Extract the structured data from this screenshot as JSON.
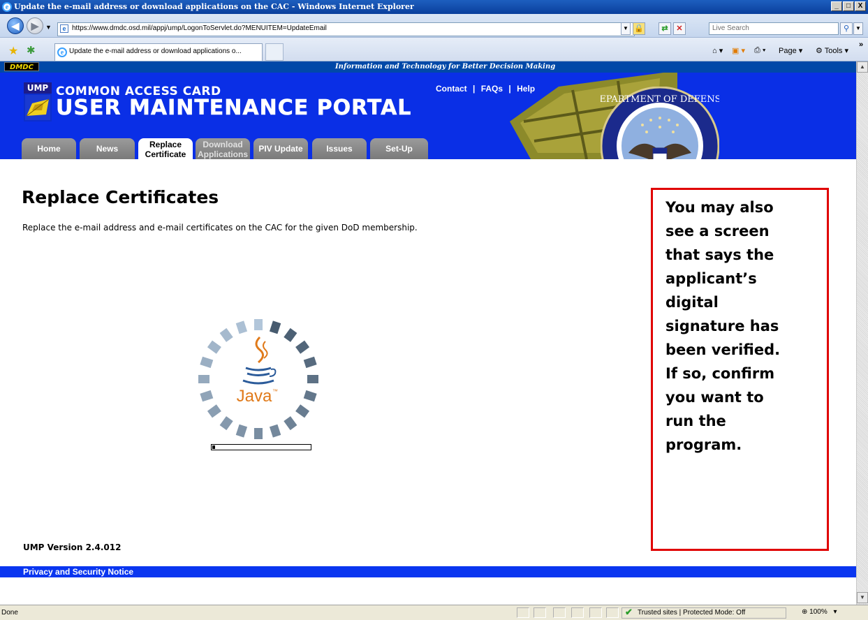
{
  "window": {
    "title": "Update the e-mail address or download applications on the CAC - Windows Internet Explorer",
    "minimize": "_",
    "maximize": "□",
    "close": "X"
  },
  "addressbar": {
    "url": "https://www.dmdc.osd.mil/appj/ump/LogonToServlet.do?MENUITEM=UpdateEmail",
    "search_placeholder": "Live Search"
  },
  "tabbar": {
    "active_tab": "Update the e-mail address or download applications o...",
    "page_label": "Page",
    "tools_label": "Tools",
    "overflow": "»"
  },
  "site": {
    "dmdc_logo": "DMDC",
    "tagline": "Information and Technology for Better Decision Making",
    "ump_label": "UMP",
    "title_line1": "COMMON ACCESS CARD",
    "title_line2": "USER MAINTENANCE PORTAL",
    "top_links": {
      "contact": "Contact",
      "faqs": "FAQs",
      "help": "Help",
      "sep": "|"
    },
    "seal_text": "DEPARTMENT OF DEFENSE",
    "nav_tabs": [
      {
        "label1": "Home",
        "label2": ""
      },
      {
        "label1": "News",
        "label2": ""
      },
      {
        "label1": "Replace",
        "label2": "Certificate"
      },
      {
        "label1": "Download",
        "label2": "Applications"
      },
      {
        "label1": "PIV Update",
        "label2": ""
      },
      {
        "label1": "Issues",
        "label2": ""
      },
      {
        "label1": "Set-Up",
        "label2": ""
      }
    ]
  },
  "main": {
    "heading": "Replace Certificates",
    "description": "Replace the e-mail address and e-mail certificates on the CAC for the given DoD membership.",
    "java_label": "Java",
    "java_tm": "™",
    "progress_fraction": 0.03,
    "version": "UMP Version 2.4.012",
    "privacy_link": "Privacy and Security Notice"
  },
  "callout": {
    "lines": [
      "You may also",
      "see a screen",
      "that says the",
      "applicant’s",
      "digital",
      "signature has",
      "been verified.",
      "If so, confirm",
      "you want to",
      "run the",
      "program."
    ],
    "border_color": "#e00000"
  },
  "statusbar": {
    "status": "Done",
    "zone": "Trusted sites | Protected Mode: Off",
    "zoom": "100%"
  },
  "colors": {
    "banner_blue": "#0a2fe6",
    "strip_blue": "#0048a8",
    "tab_gray": "#8a8a8a"
  }
}
